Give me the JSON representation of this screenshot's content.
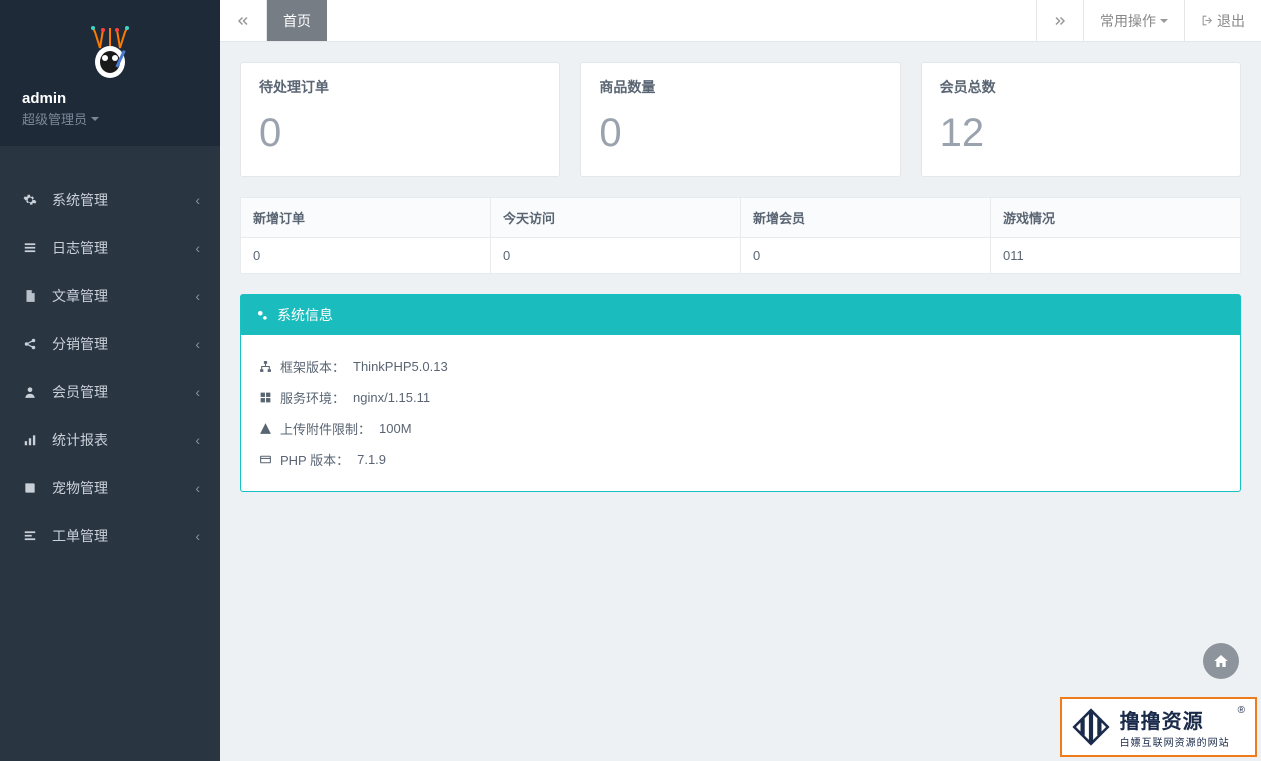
{
  "sidebar": {
    "username": "admin",
    "role": "超级管理员",
    "items": [
      {
        "label": "系统管理",
        "icon": "gear-icon"
      },
      {
        "label": "日志管理",
        "icon": "list-icon"
      },
      {
        "label": "文章管理",
        "icon": "file-icon"
      },
      {
        "label": "分销管理",
        "icon": "share-icon"
      },
      {
        "label": "会员管理",
        "icon": "user-icon"
      },
      {
        "label": "统计报表",
        "icon": "bars-icon"
      },
      {
        "label": "宠物管理",
        "icon": "book-icon"
      },
      {
        "label": "工单管理",
        "icon": "ticket-icon"
      }
    ]
  },
  "topbar": {
    "home_tab": "首页",
    "common_ops": "常用操作",
    "logout": "退出"
  },
  "stats": [
    {
      "label": "待处理订单",
      "value": "0"
    },
    {
      "label": "商品数量",
      "value": "0"
    },
    {
      "label": "会员总数",
      "value": "12"
    }
  ],
  "table": {
    "headers": [
      "新增订单",
      "今天访问",
      "新增会员",
      "游戏情况"
    ],
    "row": [
      "0",
      "0",
      "0",
      "011"
    ]
  },
  "sysinfo": {
    "title": "系统信息",
    "rows": [
      {
        "icon": "sitemap-icon",
        "label": "框架版本：",
        "value": "ThinkPHP5.0.13"
      },
      {
        "icon": "windows-icon",
        "label": "服务环境：",
        "value": "nginx/1.15.11"
      },
      {
        "icon": "warning-icon",
        "label": "上传附件限制：",
        "value": "100M"
      },
      {
        "icon": "card-icon",
        "label": "PHP 版本：",
        "value": "7.1.9"
      }
    ]
  },
  "watermark": {
    "line1": "撸撸资源",
    "line2": "白嫖互联网资源的网站",
    "reg": "®"
  }
}
